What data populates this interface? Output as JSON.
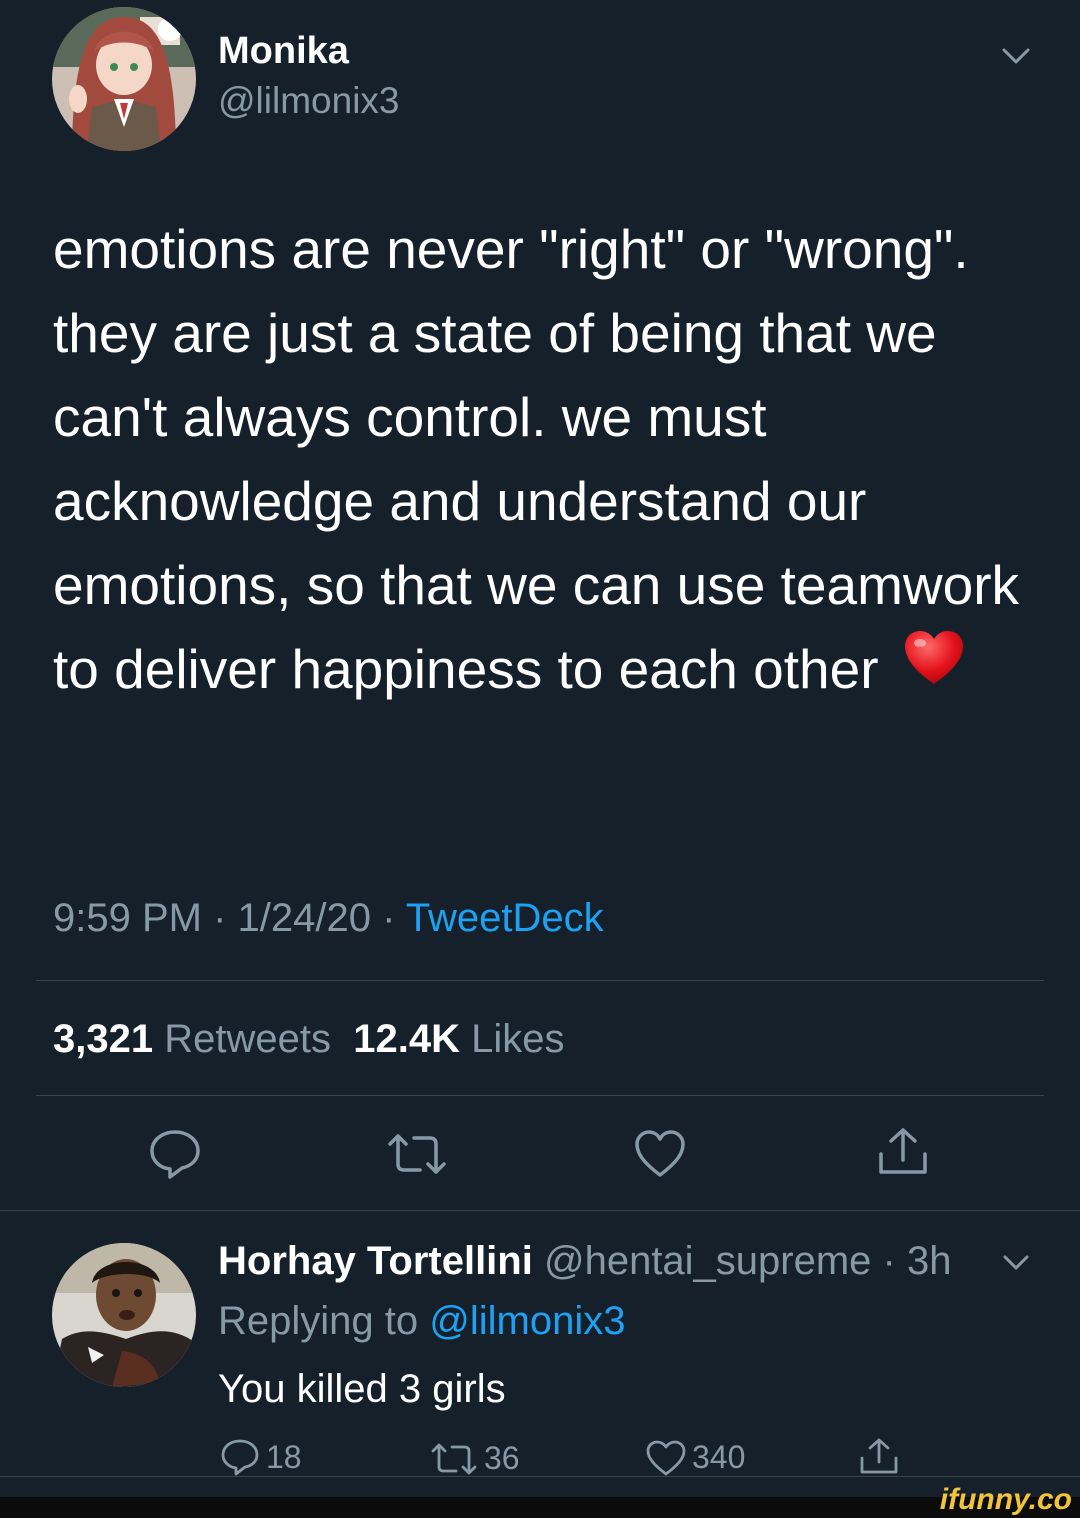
{
  "tweet": {
    "author": {
      "name": "Monika",
      "handle": "@lilmonix3"
    },
    "text": "emotions are never \"right\" or \"wrong\". they are just a state of being that we can't always control. we must acknowledge and understand our emotions, so that we can use teamwork to deliver happiness to each other",
    "emoji": "❤️",
    "time": "9:59 PM",
    "sep1": " · ",
    "date": "1/24/20",
    "sep2": " · ",
    "source": "TweetDeck",
    "retweets_count": "3,321",
    "retweets_label": "Retweets",
    "likes_count": "12.4K",
    "likes_label": "Likes"
  },
  "reply": {
    "name": "Horhay Tortellini",
    "handle": "@hentai_supreme",
    "age": " · 3h",
    "replying_prefix": "Replying to",
    "replying_to": "@lilmonix3",
    "text": "You killed 3 girls",
    "reply_count": "18",
    "retweet_count": "36",
    "like_count": "340"
  },
  "watermark": "ifunny.co",
  "colors": {
    "background": "#15202b",
    "secondary_text": "#8899a6",
    "link": "#1da1f2",
    "divider": "#38444d"
  },
  "icons": {
    "reply": "speech-bubble-icon",
    "retweet": "retweet-arrows-icon",
    "like": "heart-outline-icon",
    "share": "share-upload-icon",
    "more": "chevron-down-icon"
  }
}
